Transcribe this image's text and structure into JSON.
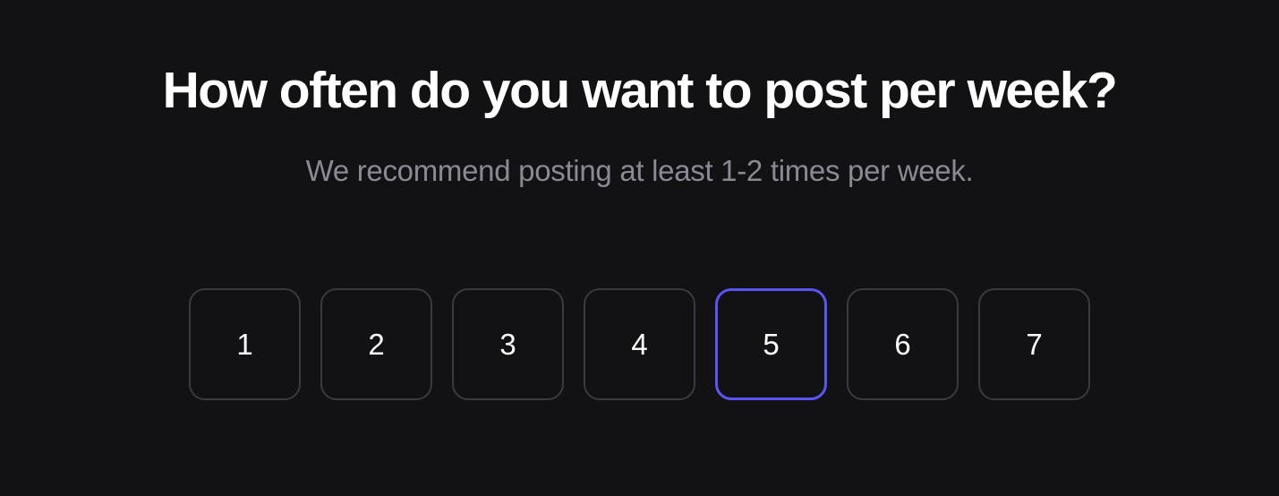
{
  "title": "How often do you want to post per week?",
  "subtitle": "We recommend posting at least 1-2 times per week.",
  "options": [
    {
      "label": "1",
      "selected": false
    },
    {
      "label": "2",
      "selected": false
    },
    {
      "label": "3",
      "selected": false
    },
    {
      "label": "4",
      "selected": false
    },
    {
      "label": "5",
      "selected": true
    },
    {
      "label": "6",
      "selected": false
    },
    {
      "label": "7",
      "selected": false
    }
  ]
}
